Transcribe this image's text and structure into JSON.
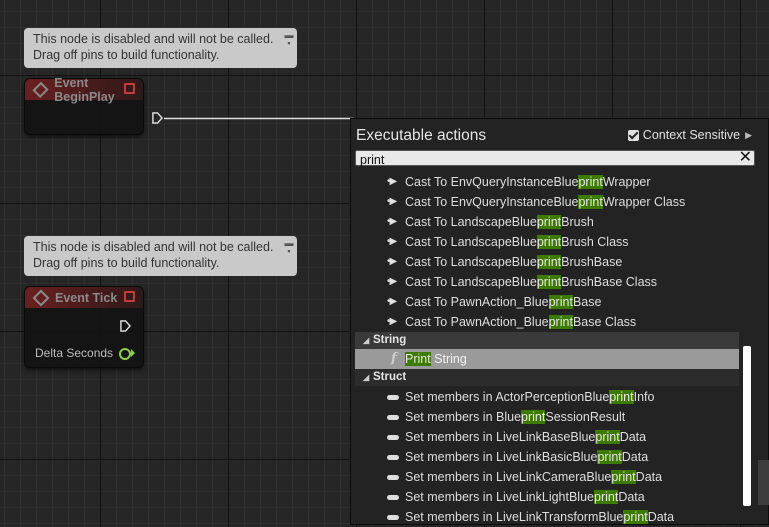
{
  "comments": [
    {
      "line1": "This node is disabled and will not be called.",
      "line2": "Drag off pins to build functionality."
    },
    {
      "line1": "This node is disabled and will not be called.",
      "line2": "Drag off pins to build functionality."
    }
  ],
  "nodes": {
    "begin_play": {
      "title": "Event BeginPlay"
    },
    "tick": {
      "title": "Event Tick",
      "pin_delta": "Delta Seconds"
    }
  },
  "menu": {
    "title": "Executable actions",
    "context_sensitive_label": "Context Sensitive",
    "search_value": "print",
    "highlight": "print",
    "rows": [
      {
        "pre": "Cast To EnvQueryInstanceBlue",
        "hl": "print",
        "post": "Wrapper"
      },
      {
        "pre": "Cast To EnvQueryInstanceBlue",
        "hl": "print",
        "post": "Wrapper Class"
      },
      {
        "pre": "Cast To LandscapeBlue",
        "hl": "print",
        "post": "Brush"
      },
      {
        "pre": "Cast To LandscapeBlue",
        "hl": "print",
        "post": "Brush Class"
      },
      {
        "pre": "Cast To LandscapeBlue",
        "hl": "print",
        "post": "BrushBase"
      },
      {
        "pre": "Cast To LandscapeBlue",
        "hl": "print",
        "post": "BrushBase Class"
      },
      {
        "pre": "Cast To PawnAction_Blue",
        "hl": "print",
        "post": "Base"
      },
      {
        "pre": "Cast To PawnAction_Blue",
        "hl": "print",
        "post": "Base Class"
      }
    ],
    "category_string": "String",
    "print_string": {
      "hl": "Print",
      "post": " String"
    },
    "category_struct": "Struct",
    "struct_rows": [
      {
        "pre": "Set members in ActorPerceptionBlue",
        "hl": "print",
        "post": "Info"
      },
      {
        "pre": "Set members in Blue",
        "hl": "print",
        "post": "SessionResult"
      },
      {
        "pre": "Set members in LiveLinkBaseBlue",
        "hl": "print",
        "post": "Data"
      },
      {
        "pre": "Set members in LiveLinkBasicBlue",
        "hl": "print",
        "post": "Data"
      },
      {
        "pre": "Set members in LiveLinkCameraBlue",
        "hl": "print",
        "post": "Data"
      },
      {
        "pre": "Set members in LiveLinkLightBlue",
        "hl": "print",
        "post": "Data"
      },
      {
        "pre": "Set members in LiveLinkTransformBlue",
        "hl": "print",
        "post": "Data"
      }
    ]
  },
  "colors": {
    "highlight": "#3d7a00",
    "event_header": "#6a1f1f",
    "delta_pin": "#8bd14a"
  }
}
